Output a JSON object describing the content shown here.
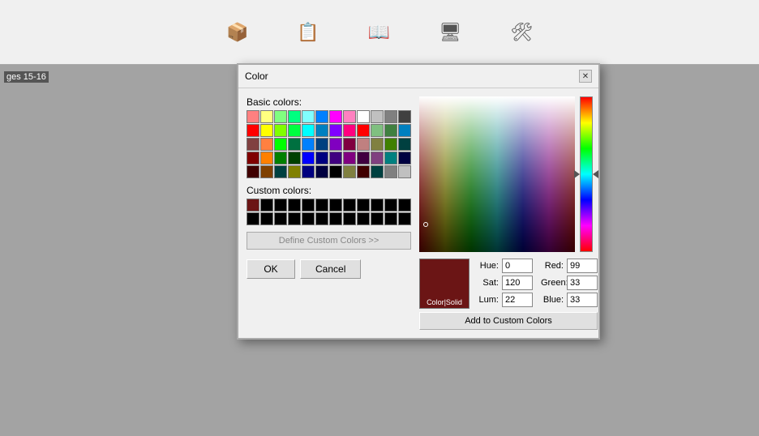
{
  "app": {
    "toolbar_icons": [
      "📦",
      "📋",
      "📖",
      "🖥",
      "🛠"
    ],
    "page_label": "ges 15-16"
  },
  "dialog": {
    "title": "Color",
    "close_label": "✕",
    "basic_colors_label": "Basic colors:",
    "custom_colors_label": "Custom colors:",
    "define_btn_label": "Define Custom Colors >>",
    "ok_label": "OK",
    "cancel_label": "Cancel",
    "add_btn_label": "Add to Custom Colors",
    "color_solid_label": "Color|Solid",
    "hue_label": "Hue:",
    "sat_label": "Sat:",
    "lum_label": "Lum:",
    "red_label": "Red:",
    "green_label": "Green:",
    "blue_label": "Blue:",
    "hue_value": "0",
    "sat_value": "120",
    "lum_value": "22",
    "red_value": "99",
    "green_value": "33",
    "blue_value": "33"
  },
  "basic_colors": [
    "#ff8080",
    "#ffff80",
    "#80ff80",
    "#00ff80",
    "#80ffff",
    "#0080ff",
    "#ff00ff",
    "#ff80c0",
    "#ff0000",
    "#ffff00",
    "#80ff00",
    "#00ff40",
    "#00ffff",
    "#0080c0",
    "#8000ff",
    "#ff0080",
    "#804040",
    "#ff8040",
    "#00ff00",
    "#007040",
    "#0080ff",
    "#004080",
    "#8000c0",
    "#800040",
    "#800000",
    "#ff8000",
    "#008000",
    "#004000",
    "#0000ff",
    "#000080",
    "#400080",
    "#800080",
    "#400000",
    "#804000",
    "#004040",
    "#808000",
    "#000080",
    "#000040",
    "#000000",
    "#808040",
    "#ff00ff",
    "#ff8080",
    "#8080ff",
    "#0000c0",
    "#0000a0",
    "#808080",
    "#c0c0c0",
    "#ffffff"
  ],
  "custom_colors": [
    "maroon",
    "black",
    "black",
    "black",
    "black",
    "black",
    "black",
    "black",
    "black",
    "black",
    "black",
    "black",
    "black",
    "black",
    "black",
    "black",
    "black",
    "black",
    "black",
    "black",
    "black",
    "black",
    "black",
    "black"
  ]
}
